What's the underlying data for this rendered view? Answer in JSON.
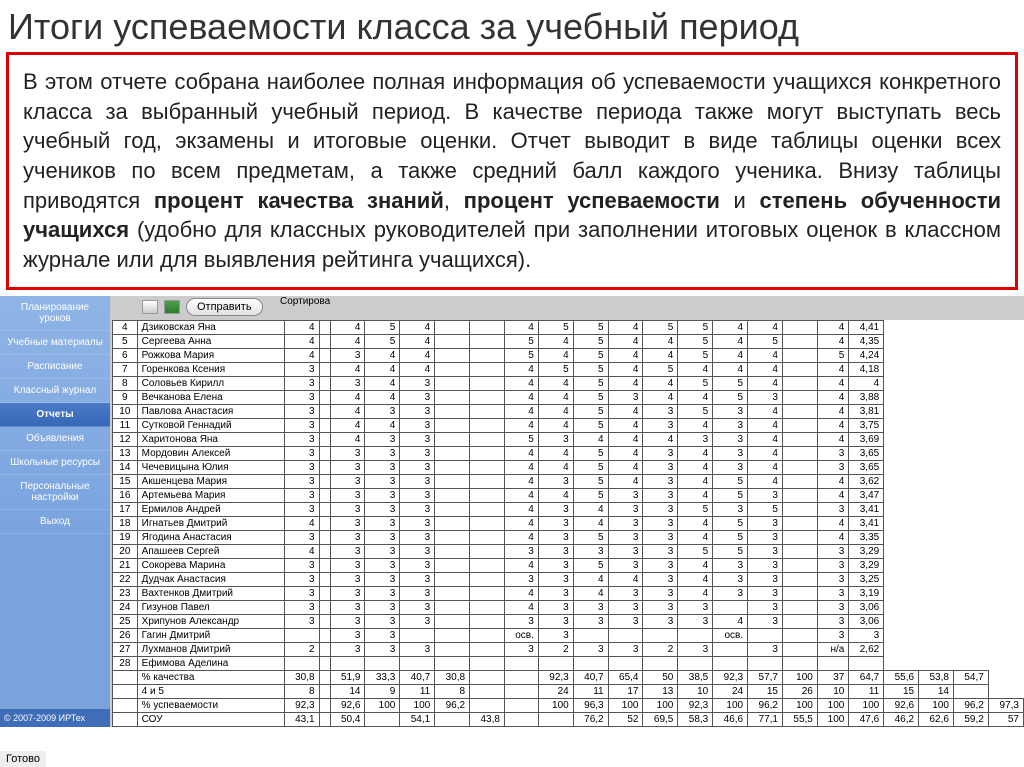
{
  "title": "Итоги успеваемости класса за учебный период",
  "description": {
    "p1a": "В этом отчете собрана наиболее полная информация об успеваемости учащихся конкретного класса за выбранный учебный период. В качестве периода также могут выступать весь учебный год, экзамены и итоговые оценки. Отчет выводит в виде таблицы оценки всех учеников по всем предметам, а также средний балл каждого ученика. Внизу таблицы приводятся ",
    "b1": "процент качества знаний",
    "sep1": ", ",
    "b2": "процент успеваемости",
    "sep2": " и ",
    "b3": "степень обученности учащихся",
    "p1b": " (удобно для классных руководителей при заполнении итоговых оценок в классном журнале или для выявления рейтинга учащихся)."
  },
  "sidebar": {
    "items": [
      "Планирование уроков",
      "Учебные материалы",
      "Расписание",
      "Классный журнал",
      "Отчеты",
      "Объявления",
      "Школьные ресурсы",
      "Персональные настройки",
      "Выход"
    ],
    "active_index": 4,
    "footer": "© 2007-2009 ИРТех"
  },
  "controls": {
    "sort_label": "Сортирова",
    "send": "Отправить"
  },
  "table": {
    "students": [
      {
        "n": 4,
        "name": "Дзиковская Яна",
        "g": [
          "4",
          "",
          "4",
          "5",
          "4",
          "",
          "",
          "4",
          "5",
          "5",
          "4",
          "5",
          "5",
          "4",
          "4",
          "",
          "4",
          "4,41"
        ]
      },
      {
        "n": 5,
        "name": "Сергеева Анна",
        "g": [
          "4",
          "",
          "4",
          "5",
          "4",
          "",
          "",
          "5",
          "4",
          "5",
          "4",
          "4",
          "5",
          "4",
          "5",
          "",
          "4",
          "4,35"
        ]
      },
      {
        "n": 6,
        "name": "Рожкова Мария",
        "g": [
          "4",
          "",
          "3",
          "4",
          "4",
          "",
          "",
          "5",
          "4",
          "5",
          "4",
          "4",
          "5",
          "4",
          "4",
          "",
          "5",
          "4,24"
        ]
      },
      {
        "n": 7,
        "name": "Горенкова Ксения",
        "g": [
          "3",
          "",
          "4",
          "4",
          "4",
          "",
          "",
          "4",
          "5",
          "5",
          "4",
          "5",
          "4",
          "4",
          "4",
          "",
          "4",
          "4,18"
        ]
      },
      {
        "n": 8,
        "name": "Соловьев Кирилл",
        "g": [
          "3",
          "",
          "3",
          "4",
          "3",
          "",
          "",
          "4",
          "4",
          "5",
          "4",
          "4",
          "5",
          "5",
          "4",
          "",
          "4",
          "4"
        ]
      },
      {
        "n": 9,
        "name": "Вечканова Елена",
        "g": [
          "3",
          "",
          "4",
          "4",
          "3",
          "",
          "",
          "4",
          "4",
          "5",
          "3",
          "4",
          "4",
          "5",
          "3",
          "",
          "4",
          "3,88"
        ]
      },
      {
        "n": 10,
        "name": "Павлова Анастасия",
        "g": [
          "3",
          "",
          "4",
          "3",
          "3",
          "",
          "",
          "4",
          "4",
          "5",
          "4",
          "3",
          "5",
          "3",
          "4",
          "",
          "4",
          "3,81"
        ]
      },
      {
        "n": 11,
        "name": "Сутковой Геннадий",
        "g": [
          "3",
          "",
          "4",
          "4",
          "3",
          "",
          "",
          "4",
          "4",
          "5",
          "4",
          "3",
          "4",
          "3",
          "4",
          "",
          "4",
          "3,75"
        ]
      },
      {
        "n": 12,
        "name": "Харитонова Яна",
        "g": [
          "3",
          "",
          "4",
          "3",
          "3",
          "",
          "",
          "5",
          "3",
          "4",
          "4",
          "4",
          "3",
          "3",
          "4",
          "",
          "4",
          "3,69"
        ]
      },
      {
        "n": 13,
        "name": "Мордовин Алексей",
        "g": [
          "3",
          "",
          "3",
          "3",
          "3",
          "",
          "",
          "4",
          "4",
          "5",
          "4",
          "3",
          "4",
          "3",
          "4",
          "",
          "3",
          "3,65"
        ]
      },
      {
        "n": 14,
        "name": "Чечевицына Юлия",
        "g": [
          "3",
          "",
          "3",
          "3",
          "3",
          "",
          "",
          "4",
          "4",
          "5",
          "4",
          "3",
          "4",
          "3",
          "4",
          "",
          "3",
          "3,65"
        ]
      },
      {
        "n": 15,
        "name": "Акшенцева Мария",
        "g": [
          "3",
          "",
          "3",
          "3",
          "3",
          "",
          "",
          "4",
          "3",
          "5",
          "4",
          "3",
          "4",
          "5",
          "4",
          "",
          "4",
          "3,62"
        ]
      },
      {
        "n": 16,
        "name": "Артемьева Мария",
        "g": [
          "3",
          "",
          "3",
          "3",
          "3",
          "",
          "",
          "4",
          "4",
          "5",
          "3",
          "3",
          "4",
          "5",
          "3",
          "",
          "4",
          "3,47"
        ]
      },
      {
        "n": 17,
        "name": "Ермилов Андрей",
        "g": [
          "3",
          "",
          "3",
          "3",
          "3",
          "",
          "",
          "4",
          "3",
          "4",
          "3",
          "3",
          "5",
          "3",
          "5",
          "",
          "3",
          "3,41"
        ]
      },
      {
        "n": 18,
        "name": "Игнатьев Дмитрий",
        "g": [
          "4",
          "",
          "3",
          "3",
          "3",
          "",
          "",
          "4",
          "3",
          "4",
          "3",
          "3",
          "4",
          "5",
          "3",
          "",
          "4",
          "3,41"
        ]
      },
      {
        "n": 19,
        "name": "Ягодина Анастасия",
        "g": [
          "3",
          "",
          "3",
          "3",
          "3",
          "",
          "",
          "4",
          "3",
          "5",
          "3",
          "3",
          "4",
          "5",
          "3",
          "",
          "4",
          "3,35"
        ]
      },
      {
        "n": 20,
        "name": "Апашеев Сергей",
        "g": [
          "4",
          "",
          "3",
          "3",
          "3",
          "",
          "",
          "3",
          "3",
          "3",
          "3",
          "3",
          "5",
          "5",
          "3",
          "",
          "3",
          "3,29"
        ]
      },
      {
        "n": 21,
        "name": "Сокорева Марина",
        "g": [
          "3",
          "",
          "3",
          "3",
          "3",
          "",
          "",
          "4",
          "3",
          "5",
          "3",
          "3",
          "4",
          "3",
          "3",
          "",
          "3",
          "3,29"
        ]
      },
      {
        "n": 22,
        "name": "Дудчак Анастасия",
        "g": [
          "3",
          "",
          "3",
          "3",
          "3",
          "",
          "",
          "3",
          "3",
          "4",
          "4",
          "3",
          "4",
          "3",
          "3",
          "",
          "3",
          "3,25"
        ]
      },
      {
        "n": 23,
        "name": "Вахтенков Дмитрий",
        "g": [
          "3",
          "",
          "3",
          "3",
          "3",
          "",
          "",
          "4",
          "3",
          "4",
          "3",
          "3",
          "4",
          "3",
          "3",
          "",
          "3",
          "3,19"
        ]
      },
      {
        "n": 24,
        "name": "Гизунов Павел",
        "g": [
          "3",
          "",
          "3",
          "3",
          "3",
          "",
          "",
          "4",
          "3",
          "3",
          "3",
          "3",
          "3",
          "",
          "3",
          "",
          "3",
          "3,06"
        ]
      },
      {
        "n": 25,
        "name": "Хрипунов Александр",
        "g": [
          "3",
          "",
          "3",
          "3",
          "3",
          "",
          "",
          "3",
          "3",
          "3",
          "3",
          "3",
          "3",
          "4",
          "3",
          "",
          "3",
          "3,06"
        ]
      },
      {
        "n": 26,
        "name": "Гагин Дмитрий",
        "g": [
          "",
          "",
          "3",
          "3",
          "",
          "",
          "",
          "осв.",
          "3",
          "",
          "",
          "",
          "",
          "осв.",
          "",
          "",
          "3",
          "3"
        ]
      },
      {
        "n": 27,
        "name": "Лухманов Дмитрий",
        "g": [
          "2",
          "",
          "3",
          "3",
          "3",
          "",
          "",
          "3",
          "2",
          "3",
          "3",
          "2",
          "3",
          "",
          "3",
          "",
          "н/а",
          "2,62"
        ]
      },
      {
        "n": 28,
        "name": "Ефимова Аделина",
        "g": [
          "",
          "",
          "",
          "",
          "",
          "",
          "",
          "",
          "",
          "",
          "",
          "",
          "",
          "",
          "",
          "",
          "",
          ""
        ]
      }
    ],
    "summary_rows": [
      {
        "label": "% качества",
        "v": [
          "30,8",
          "",
          "51,9",
          "33,3",
          "40,7",
          "30,8",
          "",
          "",
          "92,3",
          "40,7",
          "65,4",
          "50",
          "38,5",
          "92,3",
          "57,7",
          "100",
          "37",
          "64,7",
          "55,6",
          "53,8",
          "54,7"
        ]
      },
      {
        "label": "4 и 5",
        "v": [
          "8",
          "",
          "14",
          "9",
          "11",
          "8",
          "",
          "",
          "24",
          "11",
          "17",
          "13",
          "10",
          "24",
          "15",
          "26",
          "10",
          "11",
          "15",
          "14",
          ""
        ]
      },
      {
        "label": "% успеваемости",
        "v": [
          "92,3",
          "",
          "92,6",
          "100",
          "100",
          "96,2",
          "",
          "",
          "100",
          "96,3",
          "100",
          "100",
          "92,3",
          "100",
          "96,2",
          "100",
          "100",
          "100",
          "92,6",
          "100",
          "96,2",
          "97,3"
        ]
      },
      {
        "label": "СОУ",
        "v": [
          "43,1",
          "",
          "50,4",
          "",
          "54,1",
          "",
          "43,8",
          "",
          "",
          "76,2",
          "52",
          "69,5",
          "58,3",
          "46,6",
          "77,1",
          "55,5",
          "100",
          "47,6",
          "46,2",
          "62,6",
          "59,2",
          "57"
        ]
      }
    ]
  },
  "status": "Готово"
}
